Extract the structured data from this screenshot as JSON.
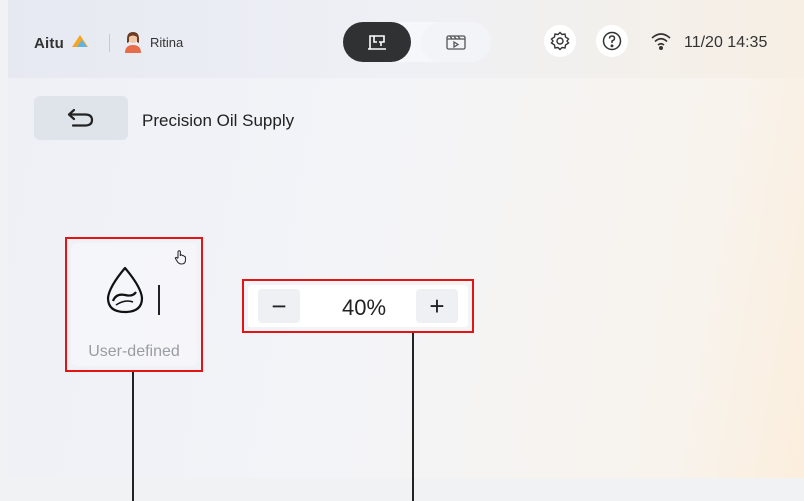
{
  "header": {
    "logo_text": "Aitu",
    "user_name": "Ritina",
    "datetime": "11/20 14:35",
    "mode_toggle": [
      {
        "icon": "sewing-machine-icon",
        "active": true
      },
      {
        "icon": "video-preview-icon",
        "active": false
      }
    ],
    "icons": [
      "settings-icon",
      "help-icon",
      "wifi-icon"
    ]
  },
  "page": {
    "title": "Precision Oil Supply",
    "back_icon": "back-arrow-icon"
  },
  "oil_mode": {
    "label": "User-defined",
    "icon": "oil-drop-icon",
    "touch_icon": "touch-hand-icon"
  },
  "stepper": {
    "value": "40%",
    "minus_label": "−",
    "plus_label": "+"
  },
  "colors": {
    "highlight": "#e21414",
    "accent_dark": "#2f3133",
    "logo_orange": "#f5a623"
  }
}
